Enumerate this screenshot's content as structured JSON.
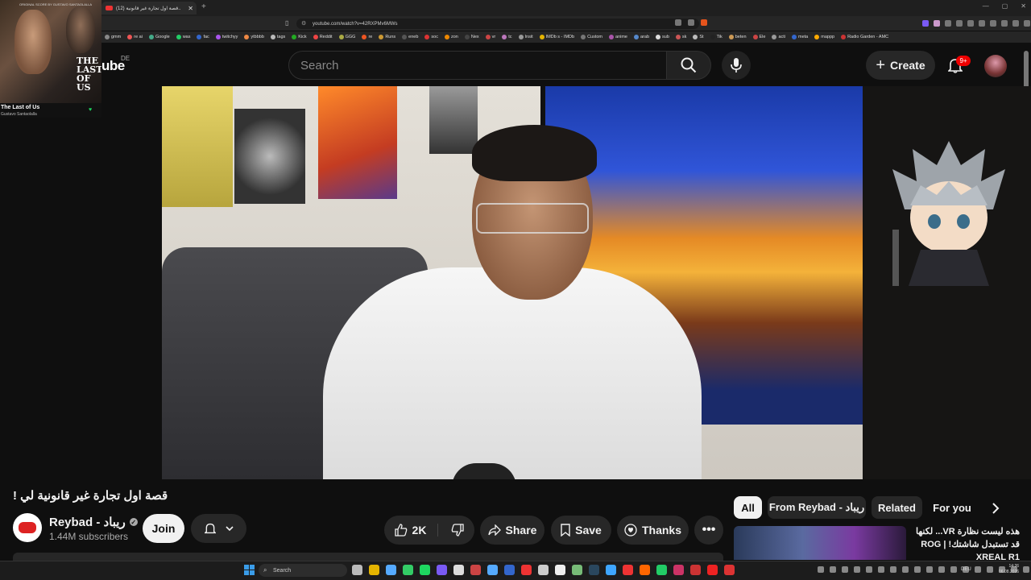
{
  "browser": {
    "tab_title": "(12) قصة اول تجارة غير قانونية...",
    "url": "youtube.com/watch?v=42RXPMv6MWs",
    "bookmarks": [
      "gmm",
      "re ai",
      "Google",
      "was",
      "fac",
      "twitchyy",
      "ytbbbb",
      "tags",
      "Kick",
      "Reddit",
      "GGG",
      "re",
      "Runs",
      "eneb",
      "soc",
      "zon",
      "Nex",
      "vr",
      "tc",
      "Insit",
      "IMDb s - IMDb",
      "Custom",
      "anime",
      "arab",
      "sub",
      "sk",
      "St",
      "Tik",
      "beten",
      "Ele",
      "acti",
      "meta",
      "mappp",
      "Radio Garden - AMC"
    ],
    "colors": {
      "yt_red": "#ff0033",
      "accent_blue": "#3ea6ff"
    }
  },
  "now_playing": {
    "credit": "ORIGINAL SCORE BY GUSTAVO SANTAOLALLA",
    "logo_text": "THE LAST OF US",
    "title": "The Last of Us",
    "artist": "Gustavo Santaolalla"
  },
  "header": {
    "logo_partial": "ube",
    "country": "DE",
    "search_placeholder": "Search",
    "create_label": "Create",
    "notification_count": "9+"
  },
  "video": {
    "title": "! قصة اول تجارة غير قانونية لي",
    "channel_name": "Reybad - ريباد",
    "subscribers": "1.44M subscribers",
    "join_label": "Join",
    "like_count": "2K",
    "share_label": "Share",
    "save_label": "Save",
    "thanks_label": "Thanks"
  },
  "sidebar": {
    "chips": [
      "All",
      "From Reybad - ريباد",
      "Related",
      "For you"
    ],
    "rec_title": "هذه ليست نظارة VR... لكنها قد تستبدل شاشتك! | ROG XREAL R1"
  },
  "taskbar": {
    "search_label": "Search",
    "lang": "DEU",
    "time": "14:26",
    "date": "06.08.2026"
  }
}
